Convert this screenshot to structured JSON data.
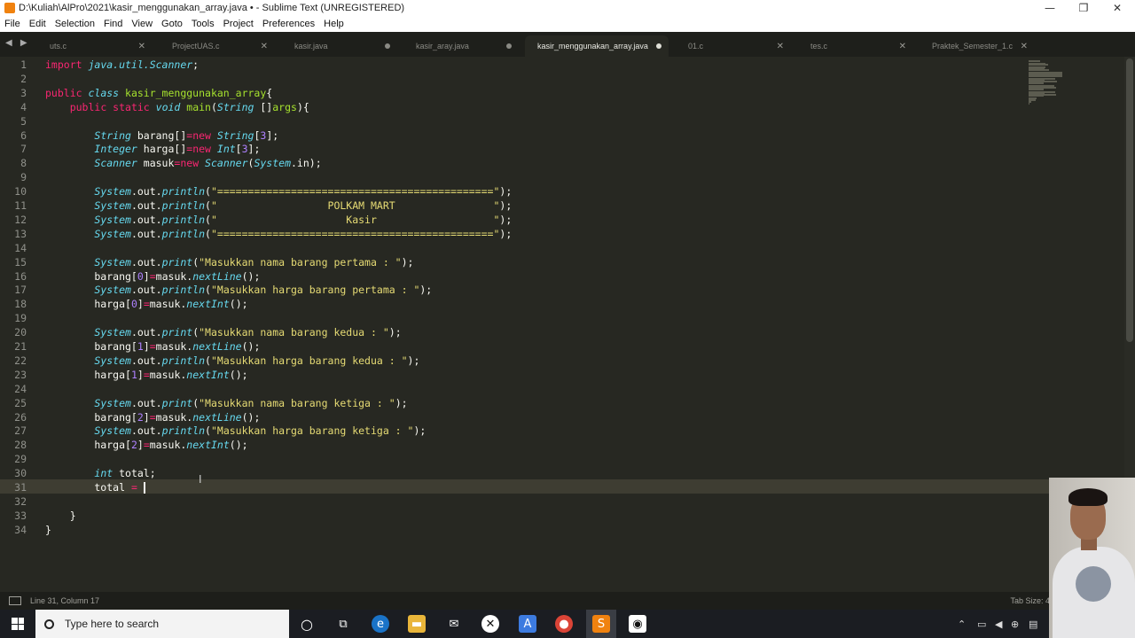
{
  "window": {
    "title": "D:\\Kuliah\\AlPro\\2021\\kasir_menggunakan_array.java • - Sublime Text (UNREGISTERED)",
    "controls": [
      "—",
      "❐",
      "✕"
    ]
  },
  "menu": [
    "File",
    "Edit",
    "Selection",
    "Find",
    "View",
    "Goto",
    "Tools",
    "Project",
    "Preferences",
    "Help"
  ],
  "tabs": [
    {
      "label": "uts.c",
      "state": "close"
    },
    {
      "label": "ProjectUAS.c",
      "state": "close"
    },
    {
      "label": "kasir.java",
      "state": "dot"
    },
    {
      "label": "kasir_aray.java",
      "state": "dot"
    },
    {
      "label": "kasir_menggunakan_array.java",
      "state": "dot",
      "active": true
    },
    {
      "label": "01.c",
      "state": "close"
    },
    {
      "label": "tes.c",
      "state": "close"
    },
    {
      "label": "Praktek_Semester_1.c",
      "state": "close"
    }
  ],
  "tab_nav": "◀ ▶",
  "editor": {
    "line_numbers": [
      "1",
      "2",
      "3",
      "4",
      "5",
      "6",
      "7",
      "8",
      "9",
      "10",
      "11",
      "12",
      "13",
      "14",
      "15",
      "16",
      "17",
      "18",
      "19",
      "20",
      "21",
      "22",
      "23",
      "24",
      "25",
      "26",
      "27",
      "28",
      "29",
      "30",
      "31",
      "32",
      "33",
      "34"
    ],
    "code": [
      {
        "t": "kw",
        "v": "import"
      },
      {
        "t": "it",
        "v": " java.util.Scanner"
      },
      {
        "t": "pl",
        "v": ";"
      }
    ]
  },
  "code_lines": [
    [
      [
        "kw",
        "import "
      ],
      [
        "it",
        "java.util.Scanner"
      ],
      [
        "pl",
        ";"
      ]
    ],
    [],
    [
      [
        "kw",
        "public "
      ],
      [
        "it",
        "class "
      ],
      [
        "fn",
        "kasir_menggunakan_array"
      ],
      [
        "pl",
        "{"
      ]
    ],
    [
      [
        "pl",
        "    "
      ],
      [
        "kw",
        "public "
      ],
      [
        "kw",
        "static "
      ],
      [
        "it",
        "void "
      ],
      [
        "fn",
        "main"
      ],
      [
        "pl",
        "("
      ],
      [
        "it",
        "String "
      ],
      [
        "pl",
        "[]"
      ],
      [
        "fn",
        "args"
      ],
      [
        "pl",
        "){"
      ]
    ],
    [],
    [
      [
        "pl",
        "        "
      ],
      [
        "it",
        "String "
      ],
      [
        "pl",
        "barang[]"
      ],
      [
        "op",
        "="
      ],
      [
        "kw",
        "new "
      ],
      [
        "it",
        "String"
      ],
      [
        "pl",
        "["
      ],
      [
        "nm",
        "3"
      ],
      [
        "pl",
        "];"
      ]
    ],
    [
      [
        "pl",
        "        "
      ],
      [
        "it",
        "Integer "
      ],
      [
        "pl",
        "harga[]"
      ],
      [
        "op",
        "="
      ],
      [
        "kw",
        "new "
      ],
      [
        "it",
        "Int"
      ],
      [
        "pl",
        "["
      ],
      [
        "nm",
        "3"
      ],
      [
        "pl",
        "];"
      ]
    ],
    [
      [
        "pl",
        "        "
      ],
      [
        "it",
        "Scanner "
      ],
      [
        "pl",
        "masuk"
      ],
      [
        "op",
        "="
      ],
      [
        "kw",
        "new "
      ],
      [
        "it",
        "Scanner"
      ],
      [
        "pl",
        "("
      ],
      [
        "it",
        "System"
      ],
      [
        "pl",
        ".in);"
      ]
    ],
    [],
    [
      [
        "pl",
        "        "
      ],
      [
        "it",
        "System"
      ],
      [
        "pl",
        ".out."
      ],
      [
        "it",
        "println"
      ],
      [
        "pl",
        "("
      ],
      [
        "st",
        "\"=============================================\""
      ],
      [
        "pl",
        ");"
      ]
    ],
    [
      [
        "pl",
        "        "
      ],
      [
        "it",
        "System"
      ],
      [
        "pl",
        ".out."
      ],
      [
        "it",
        "println"
      ],
      [
        "pl",
        "("
      ],
      [
        "st",
        "\"                  POLKAM MART                \""
      ],
      [
        "pl",
        ");"
      ]
    ],
    [
      [
        "pl",
        "        "
      ],
      [
        "it",
        "System"
      ],
      [
        "pl",
        ".out."
      ],
      [
        "it",
        "println"
      ],
      [
        "pl",
        "("
      ],
      [
        "st",
        "\"                     Kasir                   \""
      ],
      [
        "pl",
        ");"
      ]
    ],
    [
      [
        "pl",
        "        "
      ],
      [
        "it",
        "System"
      ],
      [
        "pl",
        ".out."
      ],
      [
        "it",
        "println"
      ],
      [
        "pl",
        "("
      ],
      [
        "st",
        "\"=============================================\""
      ],
      [
        "pl",
        ");"
      ]
    ],
    [],
    [
      [
        "pl",
        "        "
      ],
      [
        "it",
        "System"
      ],
      [
        "pl",
        ".out."
      ],
      [
        "it",
        "print"
      ],
      [
        "pl",
        "("
      ],
      [
        "st",
        "\"Masukkan nama barang pertama : \""
      ],
      [
        "pl",
        ");"
      ]
    ],
    [
      [
        "pl",
        "        barang["
      ],
      [
        "nm",
        "0"
      ],
      [
        "pl",
        "]"
      ],
      [
        "op",
        "="
      ],
      [
        "pl",
        "masuk."
      ],
      [
        "it",
        "nextLine"
      ],
      [
        "pl",
        "();"
      ]
    ],
    [
      [
        "pl",
        "        "
      ],
      [
        "it",
        "System"
      ],
      [
        "pl",
        ".out."
      ],
      [
        "it",
        "println"
      ],
      [
        "pl",
        "("
      ],
      [
        "st",
        "\"Masukkan harga barang pertama : \""
      ],
      [
        "pl",
        ");"
      ]
    ],
    [
      [
        "pl",
        "        harga["
      ],
      [
        "nm",
        "0"
      ],
      [
        "pl",
        "]"
      ],
      [
        "op",
        "="
      ],
      [
        "pl",
        "masuk."
      ],
      [
        "it",
        "nextInt"
      ],
      [
        "pl",
        "();"
      ]
    ],
    [],
    [
      [
        "pl",
        "        "
      ],
      [
        "it",
        "System"
      ],
      [
        "pl",
        ".out."
      ],
      [
        "it",
        "print"
      ],
      [
        "pl",
        "("
      ],
      [
        "st",
        "\"Masukkan nama barang kedua : \""
      ],
      [
        "pl",
        ");"
      ]
    ],
    [
      [
        "pl",
        "        barang["
      ],
      [
        "nm",
        "1"
      ],
      [
        "pl",
        "]"
      ],
      [
        "op",
        "="
      ],
      [
        "pl",
        "masuk."
      ],
      [
        "it",
        "nextLine"
      ],
      [
        "pl",
        "();"
      ]
    ],
    [
      [
        "pl",
        "        "
      ],
      [
        "it",
        "System"
      ],
      [
        "pl",
        ".out."
      ],
      [
        "it",
        "println"
      ],
      [
        "pl",
        "("
      ],
      [
        "st",
        "\"Masukkan harga barang kedua : \""
      ],
      [
        "pl",
        ");"
      ]
    ],
    [
      [
        "pl",
        "        harga["
      ],
      [
        "nm",
        "1"
      ],
      [
        "pl",
        "]"
      ],
      [
        "op",
        "="
      ],
      [
        "pl",
        "masuk."
      ],
      [
        "it",
        "nextInt"
      ],
      [
        "pl",
        "();"
      ]
    ],
    [],
    [
      [
        "pl",
        "        "
      ],
      [
        "it",
        "System"
      ],
      [
        "pl",
        ".out."
      ],
      [
        "it",
        "print"
      ],
      [
        "pl",
        "("
      ],
      [
        "st",
        "\"Masukkan nama barang ketiga : \""
      ],
      [
        "pl",
        ");"
      ]
    ],
    [
      [
        "pl",
        "        barang["
      ],
      [
        "nm",
        "2"
      ],
      [
        "pl",
        "]"
      ],
      [
        "op",
        "="
      ],
      [
        "pl",
        "masuk."
      ],
      [
        "it",
        "nextLine"
      ],
      [
        "pl",
        "();"
      ]
    ],
    [
      [
        "pl",
        "        "
      ],
      [
        "it",
        "System"
      ],
      [
        "pl",
        ".out."
      ],
      [
        "it",
        "println"
      ],
      [
        "pl",
        "("
      ],
      [
        "st",
        "\"Masukkan harga barang ketiga : \""
      ],
      [
        "pl",
        ");"
      ]
    ],
    [
      [
        "pl",
        "        harga["
      ],
      [
        "nm",
        "2"
      ],
      [
        "pl",
        "]"
      ],
      [
        "op",
        "="
      ],
      [
        "pl",
        "masuk."
      ],
      [
        "it",
        "nextInt"
      ],
      [
        "pl",
        "();"
      ]
    ],
    [],
    [
      [
        "pl",
        "        "
      ],
      [
        "it",
        "int "
      ],
      [
        "pl",
        "total;"
      ]
    ],
    [
      [
        "pl",
        "        total "
      ],
      [
        "op",
        "= "
      ]
    ],
    [],
    [
      [
        "pl",
        "    }"
      ]
    ],
    [
      [
        "pl",
        "}"
      ]
    ]
  ],
  "status": {
    "position": "Line 31, Column 17",
    "tab_size": "Tab Size: 4"
  },
  "taskbar": {
    "search_placeholder": "Type here to search"
  }
}
